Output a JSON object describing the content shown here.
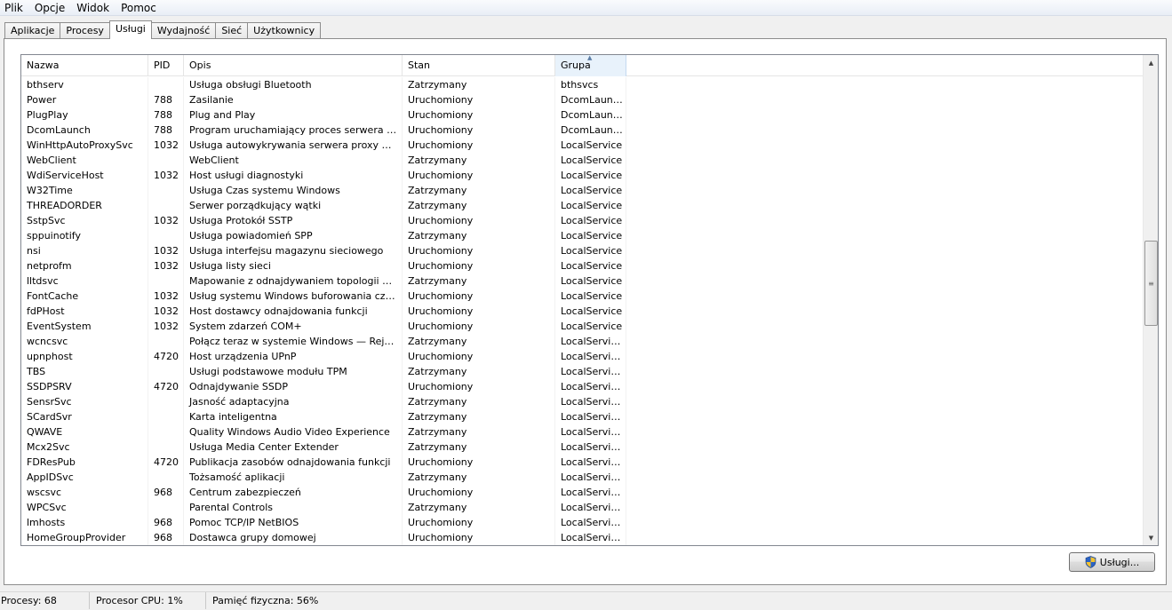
{
  "menu": [
    "Plik",
    "Opcje",
    "Widok",
    "Pomoc"
  ],
  "tabs": [
    {
      "label": "Aplikacje",
      "active": false
    },
    {
      "label": "Procesy",
      "active": false
    },
    {
      "label": "Usługi",
      "active": true
    },
    {
      "label": "Wydajność",
      "active": false
    },
    {
      "label": "Sieć",
      "active": false
    },
    {
      "label": "Użytkownicy",
      "active": false
    }
  ],
  "columns": {
    "name": "Nazwa",
    "pid": "PID",
    "desc": "Opis",
    "state": "Stan",
    "group": "Grupa"
  },
  "rows": [
    {
      "name": "bthserv",
      "pid": "",
      "desc": "Usługa obsługi Bluetooth",
      "state": "Zatrzymany",
      "group": "bthsvcs"
    },
    {
      "name": "Power",
      "pid": "788",
      "desc": "Zasilanie",
      "state": "Uruchomiony",
      "group": "DcomLaunch"
    },
    {
      "name": "PlugPlay",
      "pid": "788",
      "desc": "Plug and Play",
      "state": "Uruchomiony",
      "group": "DcomLaunch"
    },
    {
      "name": "DcomLaunch",
      "pid": "788",
      "desc": "Program uruchamiający proces serwera DCOM",
      "state": "Uruchomiony",
      "group": "DcomLaunch"
    },
    {
      "name": "WinHttpAutoProxySvc",
      "pid": "1032",
      "desc": "Usługa autowykrywania serwera proxy w sie...",
      "state": "Uruchomiony",
      "group": "LocalService"
    },
    {
      "name": "WebClient",
      "pid": "",
      "desc": "WebClient",
      "state": "Zatrzymany",
      "group": "LocalService"
    },
    {
      "name": "WdiServiceHost",
      "pid": "1032",
      "desc": "Host usługi diagnostyki",
      "state": "Uruchomiony",
      "group": "LocalService"
    },
    {
      "name": "W32Time",
      "pid": "",
      "desc": "Usługa Czas systemu Windows",
      "state": "Zatrzymany",
      "group": "LocalService"
    },
    {
      "name": "THREADORDER",
      "pid": "",
      "desc": "Serwer porządkujący wątki",
      "state": "Zatrzymany",
      "group": "LocalService"
    },
    {
      "name": "SstpSvc",
      "pid": "1032",
      "desc": "Usługa Protokół SSTP",
      "state": "Uruchomiony",
      "group": "LocalService"
    },
    {
      "name": "sppuinotify",
      "pid": "",
      "desc": "Usługa powiadomień SPP",
      "state": "Zatrzymany",
      "group": "LocalService"
    },
    {
      "name": "nsi",
      "pid": "1032",
      "desc": "Usługa interfejsu magazynu sieciowego",
      "state": "Uruchomiony",
      "group": "LocalService"
    },
    {
      "name": "netprofm",
      "pid": "1032",
      "desc": "Usługa listy sieci",
      "state": "Uruchomiony",
      "group": "LocalService"
    },
    {
      "name": "lltdsvc",
      "pid": "",
      "desc": "Mapowanie z odnajdywaniem topologii warst...",
      "state": "Zatrzymany",
      "group": "LocalService"
    },
    {
      "name": "FontCache",
      "pid": "1032",
      "desc": "Usług systemu Windows buforowania czcionek",
      "state": "Uruchomiony",
      "group": "LocalService"
    },
    {
      "name": "fdPHost",
      "pid": "1032",
      "desc": "Host dostawcy odnajdowania funkcji",
      "state": "Uruchomiony",
      "group": "LocalService"
    },
    {
      "name": "EventSystem",
      "pid": "1032",
      "desc": "System zdarzeń COM+",
      "state": "Uruchomiony",
      "group": "LocalService"
    },
    {
      "name": "wcncsvc",
      "pid": "",
      "desc": "Połącz teraz w systemie Windows — Rejestra...",
      "state": "Zatrzymany",
      "group": "LocalServic..."
    },
    {
      "name": "upnphost",
      "pid": "4720",
      "desc": "Host urządzenia UPnP",
      "state": "Uruchomiony",
      "group": "LocalServic..."
    },
    {
      "name": "TBS",
      "pid": "",
      "desc": "Usługi podstawowe modułu TPM",
      "state": "Zatrzymany",
      "group": "LocalServic..."
    },
    {
      "name": "SSDPSRV",
      "pid": "4720",
      "desc": "Odnajdywanie SSDP",
      "state": "Uruchomiony",
      "group": "LocalServic..."
    },
    {
      "name": "SensrSvc",
      "pid": "",
      "desc": "Jasność adaptacyjna",
      "state": "Zatrzymany",
      "group": "LocalServic..."
    },
    {
      "name": "SCardSvr",
      "pid": "",
      "desc": "Karta inteligentna",
      "state": "Zatrzymany",
      "group": "LocalServic..."
    },
    {
      "name": "QWAVE",
      "pid": "",
      "desc": "Quality Windows Audio Video Experience",
      "state": "Zatrzymany",
      "group": "LocalServic..."
    },
    {
      "name": "Mcx2Svc",
      "pid": "",
      "desc": "Usługa Media Center Extender",
      "state": "Zatrzymany",
      "group": "LocalServic..."
    },
    {
      "name": "FDResPub",
      "pid": "4720",
      "desc": "Publikacja zasobów odnajdowania funkcji",
      "state": "Uruchomiony",
      "group": "LocalServic..."
    },
    {
      "name": "AppIDSvc",
      "pid": "",
      "desc": "Tożsamość aplikacji",
      "state": "Zatrzymany",
      "group": "LocalServic..."
    },
    {
      "name": "wscsvc",
      "pid": "968",
      "desc": "Centrum zabezpieczeń",
      "state": "Uruchomiony",
      "group": "LocalServic..."
    },
    {
      "name": "WPCSvc",
      "pid": "",
      "desc": "Parental Controls",
      "state": "Zatrzymany",
      "group": "LocalServic..."
    },
    {
      "name": "lmhosts",
      "pid": "968",
      "desc": "Pomoc TCP/IP NetBIOS",
      "state": "Uruchomiony",
      "group": "LocalServic..."
    },
    {
      "name": "HomeGroupProvider",
      "pid": "968",
      "desc": "Dostawca grupy domowej",
      "state": "Uruchomiony",
      "group": "LocalServic..."
    }
  ],
  "services_button": {
    "label": "Usługi..."
  },
  "status": {
    "processes": "Procesy: 68",
    "cpu": "Procesor CPU: 1%",
    "memory": "Pamięć fizyczna: 56%"
  }
}
